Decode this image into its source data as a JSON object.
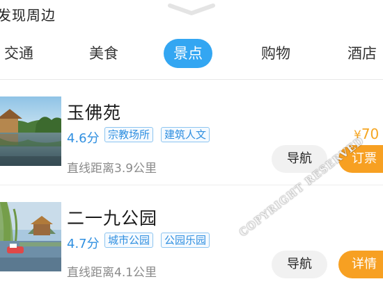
{
  "header": {
    "title": "发现周边"
  },
  "tabs": [
    {
      "label": "交通",
      "active": false
    },
    {
      "label": "美食",
      "active": false
    },
    {
      "label": "景点",
      "active": true
    },
    {
      "label": "购物",
      "active": false
    },
    {
      "label": "酒店",
      "active": false
    }
  ],
  "accent_color": "#33a6f2",
  "price_color": "#f5a623",
  "items": [
    {
      "name": "玉佛苑",
      "rating": "4.6分",
      "tags": [
        "宗教场所",
        "建筑人文"
      ],
      "distance": "直线距离3.9公里",
      "price_symbol": "¥",
      "price": "70",
      "nav_label": "导航",
      "action_label": "订票"
    },
    {
      "name": "二一九公园",
      "rating": "4.7分",
      "tags": [
        "城市公园",
        "公园乐园"
      ],
      "distance": "直线距离4.1公里",
      "nav_label": "导航",
      "action_label": "详情"
    }
  ],
  "watermark": "COPYRIGHT RESERVED"
}
